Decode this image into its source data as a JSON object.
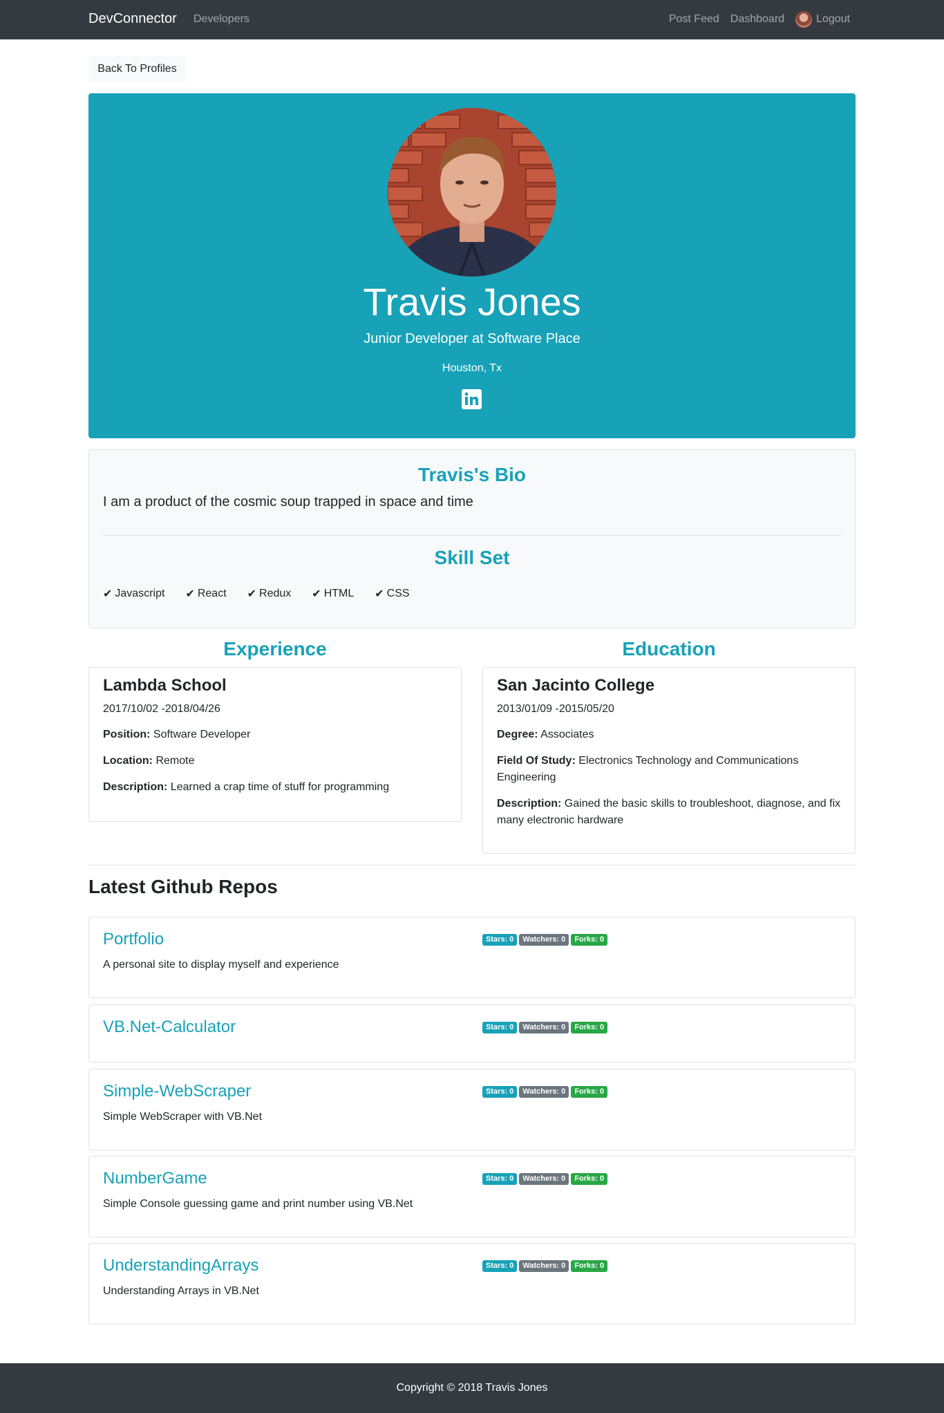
{
  "nav": {
    "brand": "DevConnector",
    "developers": "Developers",
    "post_feed": "Post Feed",
    "dashboard": "Dashboard",
    "logout": "Logout"
  },
  "back_button": "Back To Profiles",
  "profile": {
    "name": "Travis Jones",
    "title": "Junior Developer at Software Place",
    "location": "Houston, Tx",
    "social_icon": "linkedin-icon"
  },
  "bio": {
    "title": "Travis's Bio",
    "text": "I am a product of the cosmic soup trapped in space and time",
    "skills_title": "Skill Set",
    "skills": [
      "Javascript",
      "React",
      "Redux",
      "HTML",
      "CSS"
    ]
  },
  "experience": {
    "title": "Experience",
    "company": "Lambda School",
    "dates": "2017/10/02 -2018/04/26",
    "position_label": "Position:",
    "position": "Software Developer",
    "location_label": "Location:",
    "location": "Remote",
    "description_label": "Description:",
    "description": "Learned a crap time of stuff for programming"
  },
  "education": {
    "title": "Education",
    "school": "San Jacinto College",
    "dates": "2013/01/09 -2015/05/20",
    "degree_label": "Degree:",
    "degree": "Associates",
    "field_label": "Field Of Study:",
    "field": "Electronics Technology and Communications Engineering",
    "description_label": "Description:",
    "description": "Gained the basic skills to troubleshoot, diagnose, and fix many electronic hardware"
  },
  "repos": {
    "heading": "Latest Github Repos",
    "items": [
      {
        "name": "Portfolio",
        "description": "A personal site to display myself and experience",
        "stars": "Stars: 0",
        "watchers": "Watchers: 0",
        "forks": "Forks: 0"
      },
      {
        "name": "VB.Net-Calculator",
        "description": "",
        "stars": "Stars: 0",
        "watchers": "Watchers: 0",
        "forks": "Forks: 0"
      },
      {
        "name": "Simple-WebScraper",
        "description": "Simple WebScraper with VB.Net",
        "stars": "Stars: 0",
        "watchers": "Watchers: 0",
        "forks": "Forks: 0"
      },
      {
        "name": "NumberGame",
        "description": "Simple Console guessing game and print number using VB.Net",
        "stars": "Stars: 0",
        "watchers": "Watchers: 0",
        "forks": "Forks: 0"
      },
      {
        "name": "UnderstandingArrays",
        "description": "Understanding Arrays in VB.Net",
        "stars": "Stars: 0",
        "watchers": "Watchers: 0",
        "forks": "Forks: 0"
      }
    ]
  },
  "footer": "Copyright © 2018 Travis Jones",
  "colors": {
    "accent": "#17a2b8",
    "dark": "#343a40",
    "success": "#28a745",
    "secondary": "#6c757d"
  }
}
